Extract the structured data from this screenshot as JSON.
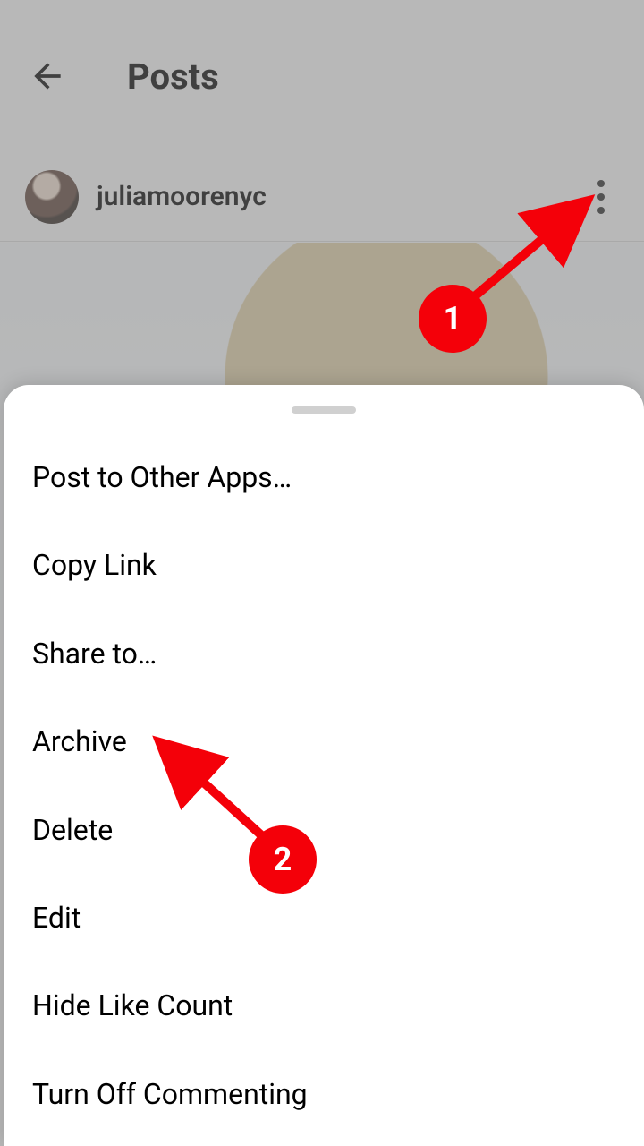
{
  "header": {
    "title": "Posts"
  },
  "post": {
    "username": "juliamoorenyc"
  },
  "menu": {
    "items": [
      "Post to Other Apps…",
      "Copy Link",
      "Share to…",
      "Archive",
      "Delete",
      "Edit",
      "Hide Like Count",
      "Turn Off Commenting"
    ]
  },
  "annotations": {
    "badge1": "1",
    "badge2": "2"
  }
}
